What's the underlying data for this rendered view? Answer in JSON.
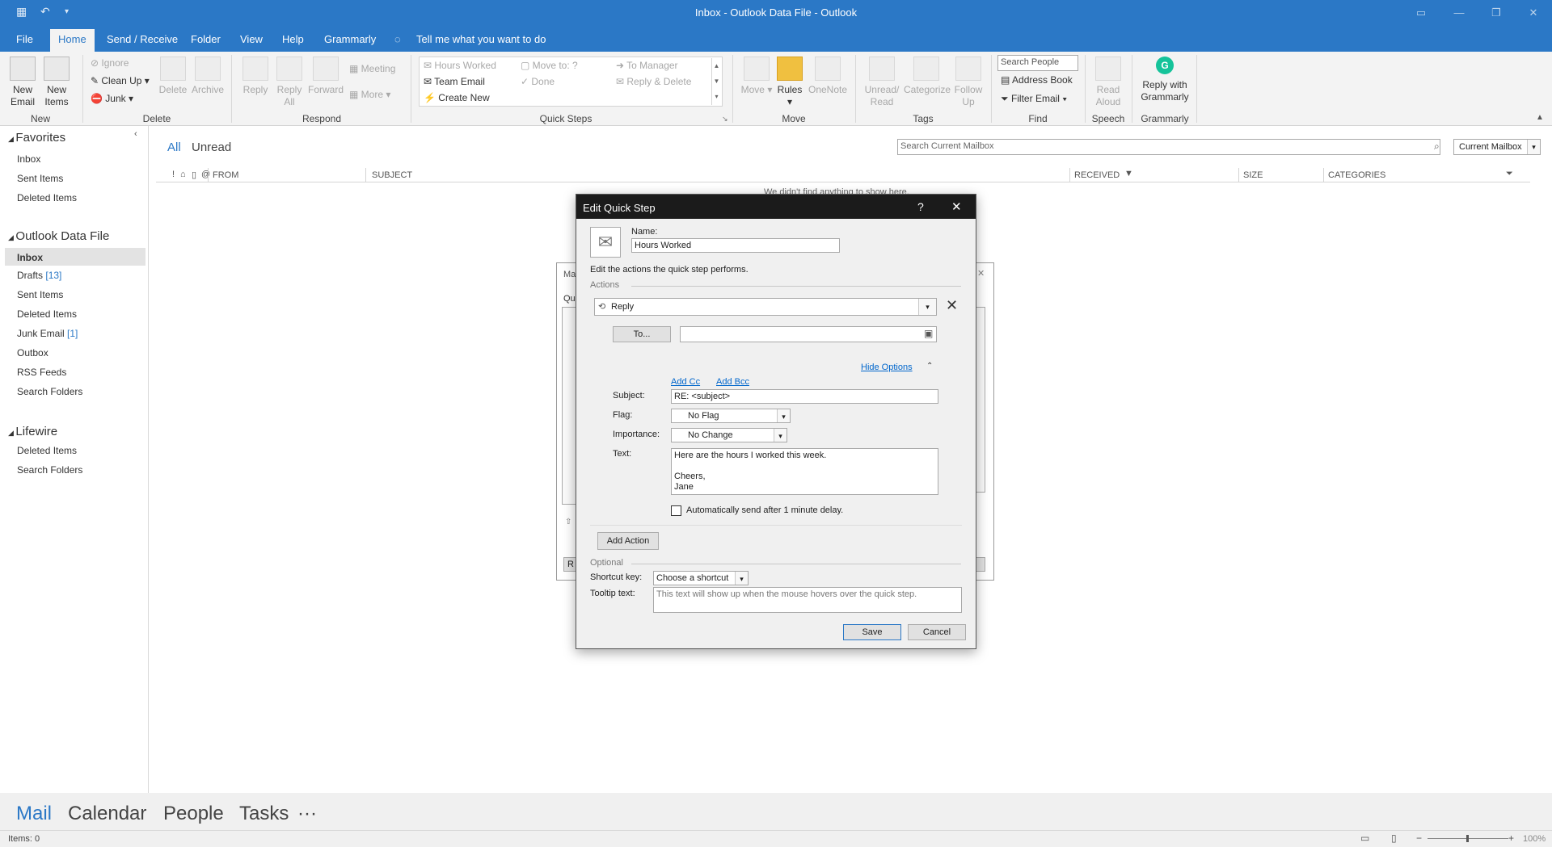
{
  "window": {
    "title": "Inbox - Outlook Data File  -  Outlook"
  },
  "tabs": [
    {
      "label": "File"
    },
    {
      "label": "Home"
    },
    {
      "label": "Send / Receive"
    },
    {
      "label": "Folder"
    },
    {
      "label": "View"
    },
    {
      "label": "Help"
    },
    {
      "label": "Grammarly"
    }
  ],
  "tell_me": "Tell me what you want to do",
  "ribbon": {
    "new": {
      "new_email": "New Email",
      "new_items": "New Items",
      "group": "New"
    },
    "delete": {
      "ignore": "Ignore",
      "clean_up": "Clean Up",
      "junk": "Junk",
      "delete": "Delete",
      "archive": "Archive",
      "group": "Delete"
    },
    "respond": {
      "reply": "Reply",
      "reply_all": "Reply All",
      "forward": "Forward",
      "meeting": "Meeting",
      "more": "More",
      "group": "Respond"
    },
    "quick_steps": {
      "hours_worked": "Hours Worked",
      "team_email": "Team Email",
      "create_new": "Create New",
      "move_to": "Move to: ?",
      "done": "Done",
      "to_manager": "To Manager",
      "reply_delete": "Reply & Delete",
      "group": "Quick Steps"
    },
    "move": {
      "move": "Move",
      "rules": "Rules",
      "onenote": "OneNote",
      "group": "Move"
    },
    "tags": {
      "unread_read": "Unread/ Read",
      "categorize": "Categorize",
      "follow_up": "Follow Up",
      "group": "Tags"
    },
    "find": {
      "search_people": "Search People",
      "address_book": "Address Book",
      "filter_email": "Filter Email",
      "group": "Find"
    },
    "speech": {
      "read_aloud": "Read Aloud",
      "group": "Speech"
    },
    "grammarly": {
      "reply": "Reply with Grammarly",
      "group": "Grammarly"
    }
  },
  "nav": {
    "favorites": "Favorites",
    "fav_items": [
      "Inbox",
      "Sent Items",
      "Deleted Items"
    ],
    "outlook_data_file": "Outlook Data File",
    "odf_items": [
      {
        "label": "Inbox",
        "count": ""
      },
      {
        "label": "Drafts",
        "count": "[13]"
      },
      {
        "label": "Sent Items",
        "count": ""
      },
      {
        "label": "Deleted Items",
        "count": ""
      },
      {
        "label": "Junk Email",
        "count": "[1]"
      },
      {
        "label": "Outbox",
        "count": ""
      },
      {
        "label": "RSS Feeds",
        "count": ""
      },
      {
        "label": "Search Folders",
        "count": ""
      }
    ],
    "lifewire": "Lifewire",
    "lw_items": [
      "Deleted Items",
      "Search Folders"
    ]
  },
  "mail": {
    "filter_all": "All",
    "filter_unread": "Unread",
    "search_placeholder": "Search Current Mailbox",
    "scope": "Current Mailbox",
    "columns": {
      "from": "FROM",
      "subject": "SUBJECT",
      "received": "RECEIVED",
      "size": "SIZE",
      "categories": "CATEGORIES"
    },
    "empty": "We didn't find anything to show here."
  },
  "bottom_nav": [
    "Mail",
    "Calendar",
    "People",
    "Tasks",
    "···"
  ],
  "status": {
    "items": "Items: 0",
    "zoom": "100%"
  },
  "dialog": {
    "title": "Edit Quick Step",
    "help": "?",
    "close": "✕",
    "name_label": "Name:",
    "name_value": "Hours Worked",
    "instructions": "Edit the actions the quick step performs.",
    "actions_label": "Actions",
    "action": "Reply",
    "to_button": "To...",
    "hide_options": "Hide Options",
    "add_cc": "Add Cc",
    "add_bcc": "Add Bcc",
    "subject_label": "Subject:",
    "subject_value": "RE: <subject>",
    "flag_label": "Flag:",
    "flag_value": "No Flag",
    "importance_label": "Importance:",
    "importance_value": "No Change",
    "text_label": "Text:",
    "text_value": "Here are the hours I worked this week.\n\nCheers,\nJane",
    "auto_send": "Automatically send after 1 minute delay.",
    "add_action": "Add Action",
    "optional_label": "Optional",
    "shortcut_label": "Shortcut key:",
    "shortcut_value": "Choose a shortcut",
    "tooltip_label": "Tooltip text:",
    "tooltip_placeholder": "This text will show up when the mouse hovers over the quick step.",
    "save": "Save",
    "cancel": "Cancel"
  },
  "bg_dialog": {
    "title_fragment": "Ma",
    "label_fragment": "Qu",
    "button_fragment": "R"
  }
}
